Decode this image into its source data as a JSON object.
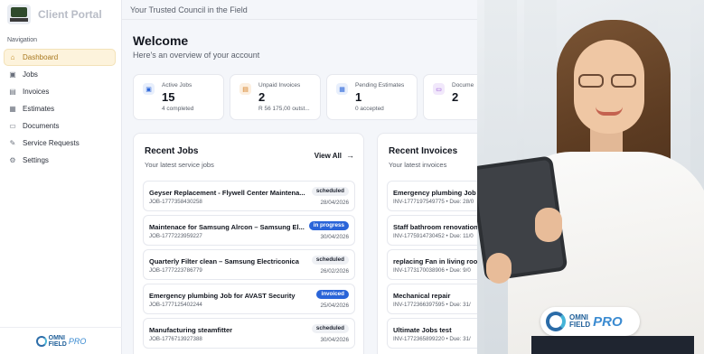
{
  "brand": {
    "title": "Client Portal"
  },
  "sidebar": {
    "section": "Navigation",
    "items": [
      {
        "label": "Dashboard",
        "icon": "home-icon",
        "glyph": "⌂"
      },
      {
        "label": "Jobs",
        "icon": "briefcase-icon",
        "glyph": "▣"
      },
      {
        "label": "Invoices",
        "icon": "file-icon",
        "glyph": "▤"
      },
      {
        "label": "Estimates",
        "icon": "calculator-icon",
        "glyph": "▦"
      },
      {
        "label": "Documents",
        "icon": "folder-icon",
        "glyph": "▭"
      },
      {
        "label": "Service Requests",
        "icon": "wrench-icon",
        "glyph": "✎"
      },
      {
        "label": "Settings",
        "icon": "gear-icon",
        "glyph": "⚙"
      }
    ],
    "footer_logo": {
      "word_top": "OMNI",
      "word_bottom": "FIELD",
      "word_pro": "PRO"
    }
  },
  "topbar": {
    "text": "Your Trusted Council in the Field"
  },
  "welcome": {
    "title": "Welcome",
    "subtitle": "Here's an overview of your account"
  },
  "stats": [
    {
      "label": "Active Jobs",
      "value": "15",
      "note": "4 completed",
      "icon": "briefcase-icon",
      "glyph": "▣",
      "color": "#2a64d8",
      "bg": "#e8effc"
    },
    {
      "label": "Unpaid Invoices",
      "value": "2",
      "note": "R 56 175,00 outst...",
      "icon": "file-icon",
      "glyph": "▤",
      "color": "#d27a1c",
      "bg": "#fcefe0"
    },
    {
      "label": "Pending Estimates",
      "value": "1",
      "note": "0 accepted",
      "icon": "calculator-icon",
      "glyph": "▦",
      "color": "#2a64d8",
      "bg": "#e8effc"
    },
    {
      "label": "Docume",
      "value": "2",
      "note": "",
      "icon": "folder-icon",
      "glyph": "▭",
      "color": "#8a3fd0",
      "bg": "#f1e8fb"
    }
  ],
  "recent_jobs": {
    "title": "Recent Jobs",
    "subtitle": "Your latest service jobs",
    "view_all": "View All",
    "rows": [
      {
        "title": "Geyser Replacement - Flywell Center Maintena...",
        "id": "JOB-1777358430258",
        "status": "scheduled",
        "status_class": "scheduled",
        "date": "28/04/2026"
      },
      {
        "title": "Maintenace for Samsung Alrcon – Samsung El...",
        "id": "JOB-1777223959227",
        "status": "in progress",
        "status_class": "progress",
        "date": "30/04/2026"
      },
      {
        "title": "Quarterly Filter clean – Samsung Electriconica",
        "id": "JOB-1777223786779",
        "status": "scheduled",
        "status_class": "scheduled",
        "date": "26/02/2026"
      },
      {
        "title": "Emergency plumbing Job for AVAST Security",
        "id": "JOB-1777125402244",
        "status": "invoiced",
        "status_class": "invoiced",
        "date": "25/04/2026"
      },
      {
        "title": "Manufacturing steamfitter",
        "id": "JOB-1776713927388",
        "status": "scheduled",
        "status_class": "scheduled",
        "date": "30/04/2026"
      }
    ]
  },
  "recent_invoices": {
    "title": "Recent Invoices",
    "subtitle": "Your latest invoices",
    "rows": [
      {
        "title": "Emergency plumbing Job fo",
        "id": "INV-1777197549775 • Due: 28/0"
      },
      {
        "title": "Staff bathroom renovation",
        "id": "INV-1775914730452 • Due: 11/0"
      },
      {
        "title": "replacing Fan in living room",
        "id": "INV-1773170038906 • Due: 9/0"
      },
      {
        "title": "Mechanical repair",
        "id": "INV-1772366397595 • Due: 31/"
      },
      {
        "title": "Ultimate Jobs test",
        "id": "INV-1772365899220 • Due: 31/"
      }
    ]
  },
  "photo_logo": {
    "word_top": "OMNI",
    "word_bottom": "FIELD",
    "word_pro": "PRO"
  }
}
